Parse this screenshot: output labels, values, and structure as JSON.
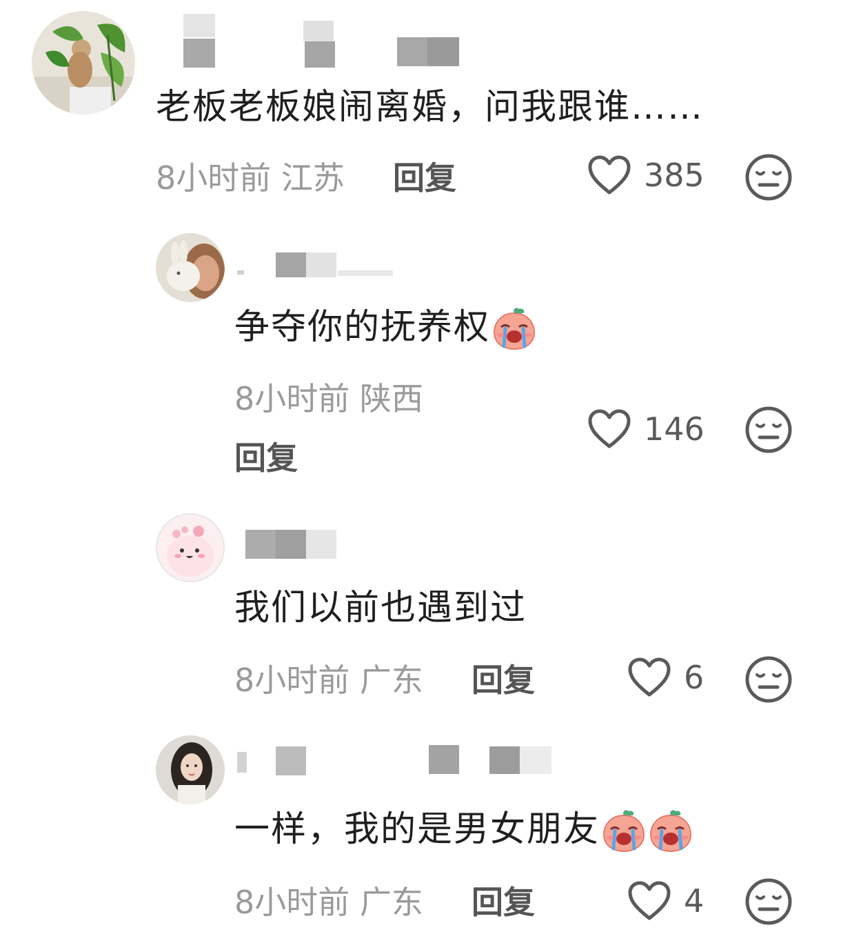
{
  "comments": [
    {
      "text": "老板老板娘闹离婚，问我跟谁……",
      "time": "8小时前",
      "location": "江苏",
      "reply_label": "回复",
      "likes": "385"
    },
    {
      "text": "争夺你的抚养权",
      "time": "8小时前",
      "location": "陕西",
      "reply_label": "回复",
      "likes": "146",
      "emoji": "crying-peach-emoji"
    },
    {
      "text": "我们以前也遇到过",
      "time": "8小时前",
      "location": "广东",
      "reply_label": "回复",
      "likes": "6"
    },
    {
      "text": "一样，我的是男女朋友",
      "time": "8小时前",
      "location": "广东",
      "reply_label": "回复",
      "likes": "4",
      "emoji": "crying-peach-emoji"
    }
  ],
  "icons": {
    "like": "heart-outline-icon",
    "dislike": "meh-face-icon"
  },
  "colors": {
    "text": "#1f1f1f",
    "meta": "#9a9a9a",
    "reply": "#555555",
    "icon": "#5a5a5a"
  }
}
